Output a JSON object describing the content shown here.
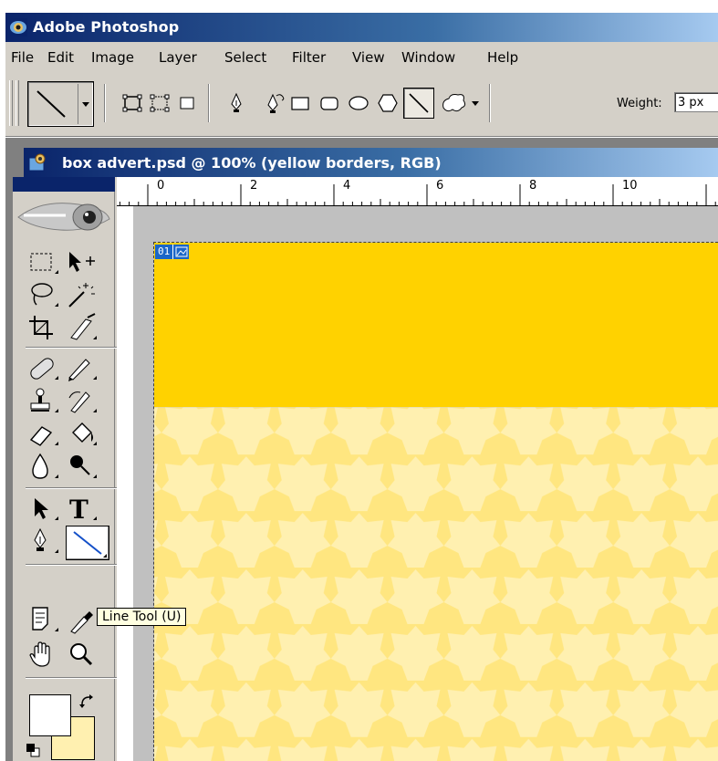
{
  "app": {
    "title": "Adobe Photoshop",
    "icon": "photoshop-eye-icon"
  },
  "menu": {
    "items": [
      "File",
      "Edit",
      "Image",
      "Layer",
      "Select",
      "Filter",
      "View",
      "Window",
      "Help"
    ]
  },
  "options_bar": {
    "tool_preset_icon": "line-tool-icon",
    "shape_layers_icon": "shape-layers-icon",
    "paths_icon": "paths-icon",
    "fill_pixels_icon": "fill-pixels-icon",
    "pen_icon": "pen-icon",
    "freeform_pen_icon": "freeform-pen-icon",
    "rectangle_icon": "rectangle-icon",
    "rounded_rectangle_icon": "rounded-rectangle-icon",
    "ellipse_icon": "ellipse-icon",
    "polygon_icon": "polygon-icon",
    "line_icon": "line-icon",
    "custom_shape_icon": "custom-shape-icon",
    "weight_label": "Weight:",
    "weight_value": "3 px"
  },
  "document": {
    "title": "box advert.psd @ 100% (yellow borders, RGB)",
    "slice_number": "01",
    "ruler_labels": [
      "0",
      "2",
      "4",
      "6",
      "8",
      "10"
    ],
    "colors": {
      "border_yellow": "#ffd200",
      "star_bg": "#ffe680",
      "star_fill": "#fff0b0"
    }
  },
  "toolbox": {
    "tooltip": "Line Tool (U)",
    "foreground_color": "#ffffff",
    "background_color": "#fff0b0"
  }
}
